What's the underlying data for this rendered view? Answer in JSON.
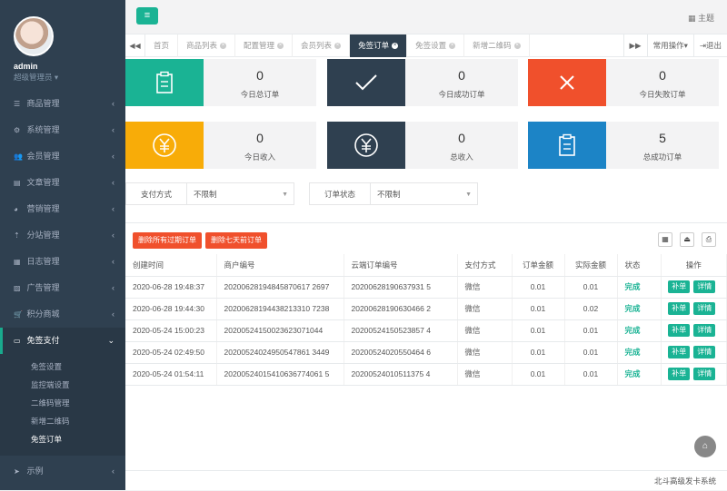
{
  "colors": {
    "sidebar": "#2f4050",
    "accent": "#1ab394",
    "card_teal": "#1ab394",
    "card_navy": "#2f4050",
    "card_red": "#f0502c",
    "card_yellow": "#f8ac08",
    "card_blue": "#1c84c6",
    "danger": "#f0502c"
  },
  "profile": {
    "name": "admin",
    "role": "超级管理员 ▾"
  },
  "sidebar": {
    "items": [
      {
        "label": "商品管理",
        "icon": "list-icon"
      },
      {
        "label": "系统管理",
        "icon": "gear-icon"
      },
      {
        "label": "会员管理",
        "icon": "users-icon"
      },
      {
        "label": "文章管理",
        "icon": "document-icon"
      },
      {
        "label": "营销管理",
        "icon": "chart-icon"
      },
      {
        "label": "分站管理",
        "icon": "sitemap-icon"
      },
      {
        "label": "日志管理",
        "icon": "calendar-icon"
      },
      {
        "label": "广告管理",
        "icon": "image-icon"
      },
      {
        "label": "积分商城",
        "icon": "cart-icon"
      }
    ],
    "active": {
      "label": "免签支付",
      "icon": "card-icon"
    },
    "sub_items": [
      "免签设置",
      "监控端设置",
      "二维码管理",
      "新增二维码",
      "免签订单"
    ],
    "bottom": {
      "label": "示例",
      "icon": "send-icon"
    }
  },
  "topbar": {
    "menu_icon": "hamburger-icon",
    "theme_label": "主题"
  },
  "tabs": [
    {
      "label": "首页",
      "closable": false
    },
    {
      "label": "商品列表",
      "closable": true
    },
    {
      "label": "配置管理",
      "closable": true
    },
    {
      "label": "会员列表",
      "closable": true
    },
    {
      "label": "免签订单",
      "closable": true,
      "active": true
    },
    {
      "label": "免签设置",
      "closable": true
    },
    {
      "label": "新增二维码",
      "closable": true
    }
  ],
  "tab_right": {
    "common_ops": "常用操作▾",
    "logout": "退出"
  },
  "stats": [
    {
      "value": "0",
      "label": "今日总订单",
      "icon": "clipboard-icon",
      "color": "#1ab394"
    },
    {
      "value": "0",
      "label": "今日成功订单",
      "icon": "check-icon",
      "color": "#2f4050"
    },
    {
      "value": "0",
      "label": "今日失败订单",
      "icon": "close-icon",
      "color": "#f0502c"
    },
    {
      "value": "0",
      "label": "今日收入",
      "icon": "yen-icon",
      "color": "#f8ac08"
    },
    {
      "value": "0",
      "label": "总收入",
      "icon": "yen-icon",
      "color": "#2f4050"
    },
    {
      "value": "5",
      "label": "总成功订单",
      "icon": "clipboard-icon",
      "color": "#1c84c6"
    }
  ],
  "filters": {
    "pay_method_label": "支付方式",
    "pay_method_value": "不限制",
    "order_status_label": "订单状态",
    "order_status_value": "不限制"
  },
  "toolbar": {
    "delete_expired": "删除所有过期订单",
    "delete_7days": "删除七天前订单"
  },
  "table": {
    "headers": [
      "创建时间",
      "商户编号",
      "云端订单编号",
      "支付方式",
      "订单金额",
      "实际金额",
      "状态",
      "操作"
    ],
    "rows": [
      [
        "2020-06-28 19:48:37",
        "20200628194845870617 2697",
        "20200628190637931 5",
        "微信",
        "0.01",
        "0.01",
        "完成"
      ],
      [
        "2020-06-28 19:44:30",
        "20200628194438213310 7238",
        "20200628190630466 2",
        "微信",
        "0.01",
        "0.02",
        "完成"
      ],
      [
        "2020-05-24 15:00:23",
        "20200524150023623071044",
        "20200524150523857 4",
        "微信",
        "0.01",
        "0.01",
        "完成"
      ],
      [
        "2020-05-24 02:49:50",
        "20200524024950547861 3449",
        "20200524020550464 6",
        "微信",
        "0.01",
        "0.01",
        "完成"
      ],
      [
        "2020-05-24 01:54:11",
        "20200524015410636774061 5",
        "20200524010511375 4",
        "微信",
        "0.01",
        "0.01",
        "完成"
      ]
    ],
    "action_fix": "补单",
    "action_detail": "详情"
  },
  "footer": "北斗高级发卡系统"
}
